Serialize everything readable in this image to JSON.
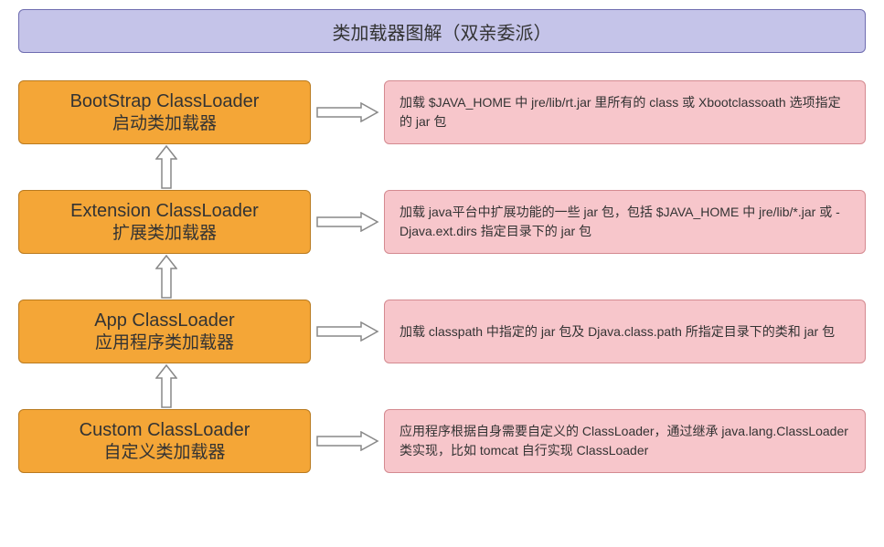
{
  "title": "类加载器图解（双亲委派）",
  "loaders": [
    {
      "title": "BootStrap ClassLoader",
      "subtitle": "启动类加载器",
      "desc": "加载 $JAVA_HOME 中 jre/lib/rt.jar 里所有的 class 或 Xbootclassoath 选项指定的 jar 包"
    },
    {
      "title": "Extension ClassLoader",
      "subtitle": "扩展类加载器",
      "desc": "加载 java平台中扩展功能的一些 jar 包，包括 $JAVA_HOME 中 jre/lib/*.jar 或 -Djava.ext.dirs 指定目录下的 jar 包"
    },
    {
      "title": "App ClassLoader",
      "subtitle": "应用程序类加载器",
      "desc": "加载 classpath 中指定的 jar 包及 Djava.class.path 所指定目录下的类和 jar 包"
    },
    {
      "title": "Custom ClassLoader",
      "subtitle": "自定义类加载器",
      "desc": "应用程序根据自身需要自定义的 ClassLoader，通过继承 java.lang.ClassLoader 类实现，比如 tomcat 自行实现 ClassLoader"
    }
  ]
}
